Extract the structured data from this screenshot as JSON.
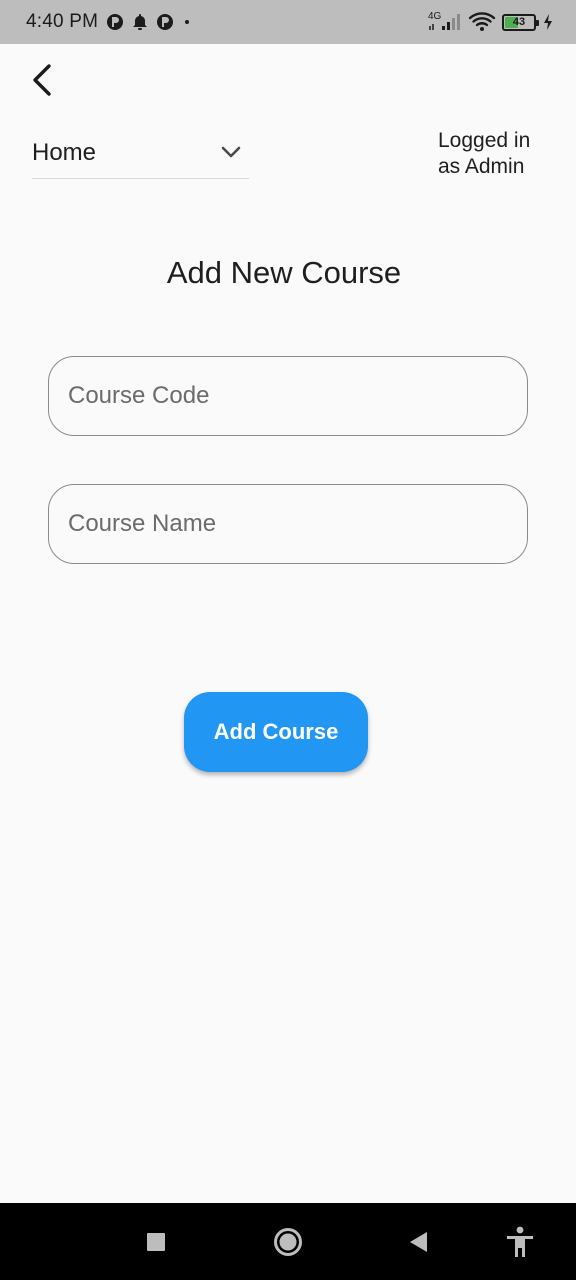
{
  "status_bar": {
    "time": "4:40 PM",
    "network_type": "4G",
    "battery_level": "43",
    "battery_fraction": 0.43,
    "icons": [
      "app-notification-icon",
      "bell-icon",
      "app-notification-icon",
      "dot-icon",
      "signal-icon",
      "wifi-icon",
      "battery-icon",
      "charging-icon"
    ]
  },
  "app_bar": {
    "back_icon": "back-arrow-icon",
    "nav_dropdown": {
      "selected": "Home",
      "icon": "chevron-down-icon"
    },
    "user_status_line1": "Logged in",
    "user_status_line2": "as Admin"
  },
  "page": {
    "title": "Add New Course"
  },
  "form": {
    "course_code": {
      "placeholder": "Course Code",
      "value": ""
    },
    "course_name": {
      "placeholder": "Course Name",
      "value": ""
    },
    "submit_label": "Add Course"
  },
  "system_nav": {
    "buttons": [
      "recent-apps-icon",
      "home-icon",
      "back-triangle-icon",
      "accessibility-icon"
    ]
  },
  "colors": {
    "primary": "#2196f3",
    "background": "#fafafa",
    "status_bar": "#bdbdbd",
    "nav_bar": "#000000",
    "field_border": "#8a8a8a"
  }
}
